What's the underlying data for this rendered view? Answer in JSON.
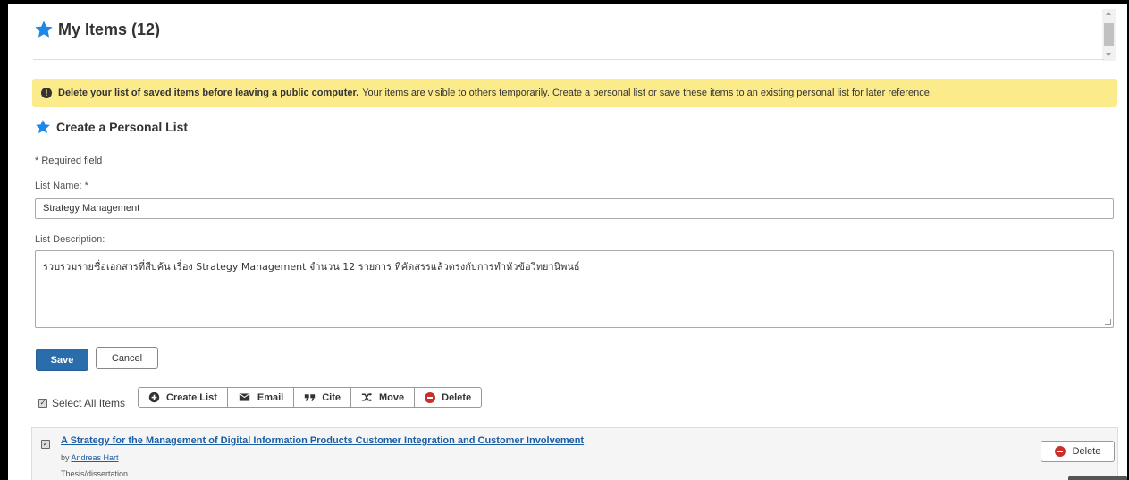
{
  "header": {
    "title": "My Items (12)"
  },
  "alert": {
    "strong": "Delete your list of saved items before leaving a public computer.",
    "text": "Your items are visible to others temporarily. Create a personal list or save these items to an existing personal list for later reference."
  },
  "form": {
    "section_title": "Create a Personal List",
    "required_note": "* Required field",
    "name_label": "List Name: *",
    "name_value": "Strategy Management",
    "desc_label": "List Description:",
    "desc_value": "รวบรวมรายชื่อเอกสารที่สืบค้น เรื่อง Strategy Management  จำนวน 12 รายการ ที่คัดสรรแล้วตรงกับการทำหัวข้อวิทยานิพนธ์",
    "save_label": "Save",
    "cancel_label": "Cancel"
  },
  "actions": {
    "select_all_label": "Select All Items",
    "select_all_checked": true,
    "create_list": "Create List",
    "email": "Email",
    "cite": "Cite",
    "move": "Move",
    "delete": "Delete"
  },
  "items": [
    {
      "title": "A Strategy for the Management of Digital Information Products Customer Integration and Customer Involvement",
      "by_prefix": "by",
      "author": "Andreas Hart",
      "type": "Thesis/dissertation",
      "checked": true,
      "delete_label": "Delete"
    }
  ],
  "colors": {
    "accent": "#2a6dad",
    "star": "#1e88e5",
    "alert_bg": "#fbeb8b",
    "delete_red": "#c9302c",
    "link": "#1a5ea6"
  }
}
